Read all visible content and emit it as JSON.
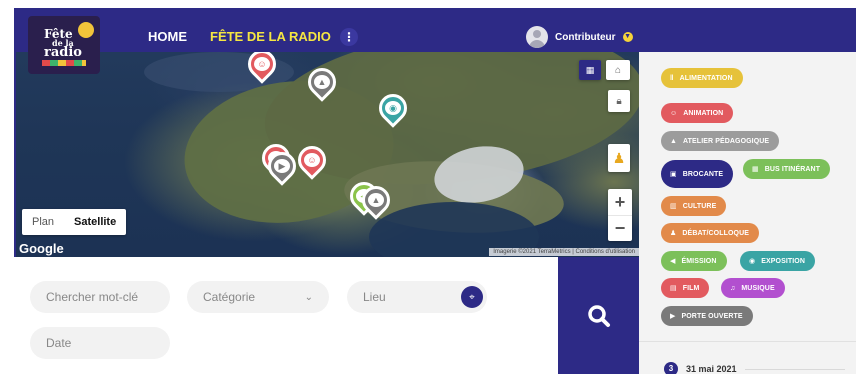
{
  "nav": {
    "logo_line1": "Fête",
    "logo_line2": "de la",
    "logo_line3": "radio",
    "home": "HOME",
    "fete": "FÊTE DE LA RADIO",
    "more": "⋮",
    "user": "Contributeur"
  },
  "map": {
    "plan": "Plan",
    "satellite": "Satellite",
    "google": "Google",
    "attribution": "Imagerie ©2021 TerraMetrics | Conditions d'utilisation",
    "markers": [
      {
        "type": "animation",
        "color": "#e25a5f",
        "glyph": "☺"
      },
      {
        "type": "atelier",
        "color": "#7a7a7a",
        "glyph": "▲"
      },
      {
        "type": "exposition",
        "color": "#3aa4a4",
        "glyph": "◉"
      },
      {
        "type": "animation",
        "color": "#e25a5f",
        "glyph": "☺"
      },
      {
        "type": "porte-ouverte",
        "color": "#7a7a7a",
        "glyph": "▶"
      },
      {
        "type": "animation",
        "color": "#e25a5f",
        "glyph": "☺"
      },
      {
        "type": "emission",
        "color": "#8bc34a",
        "glyph": "◀"
      },
      {
        "type": "atelier",
        "color": "#7a7a7a",
        "glyph": "▲"
      }
    ]
  },
  "search": {
    "keyword_placeholder": "Chercher mot-clé",
    "category_placeholder": "Catégorie",
    "location_placeholder": "Lieu",
    "date_placeholder": "Date"
  },
  "tags": [
    {
      "label": "ALIMENTATION",
      "color": "#e6c23a",
      "icon": "‖"
    },
    {
      "label": "ANIMATION",
      "color": "#e25a5f",
      "icon": "☺"
    },
    {
      "label": "ATELIER PÉDAGOGIQUE",
      "color": "#9c9c9c",
      "icon": "▲"
    },
    {
      "label": "BROCANTE",
      "color": "#2d2a86",
      "icon": "▣"
    },
    {
      "label": "BUS ITINÉRANT",
      "color": "#7cc05a",
      "icon": "▦"
    },
    {
      "label": "CULTURE",
      "color": "#e28a4a",
      "icon": "▥"
    },
    {
      "label": "DÉBAT/COLLOQUE",
      "color": "#e28a4a",
      "icon": "♟"
    },
    {
      "label": "ÉMISSION",
      "color": "#7cc05a",
      "icon": "◀"
    },
    {
      "label": "EXPOSITION",
      "color": "#3aa4a4",
      "icon": "◉"
    },
    {
      "label": "FILM",
      "color": "#e25a5f",
      "icon": "▤"
    },
    {
      "label": "MUSIQUE",
      "color": "#b24fcf",
      "icon": "♫"
    },
    {
      "label": "PORTE OUVERTE",
      "color": "#7a7a7a",
      "icon": "▶"
    }
  ],
  "list": {
    "count": "3",
    "date": "31 mai 2021"
  }
}
